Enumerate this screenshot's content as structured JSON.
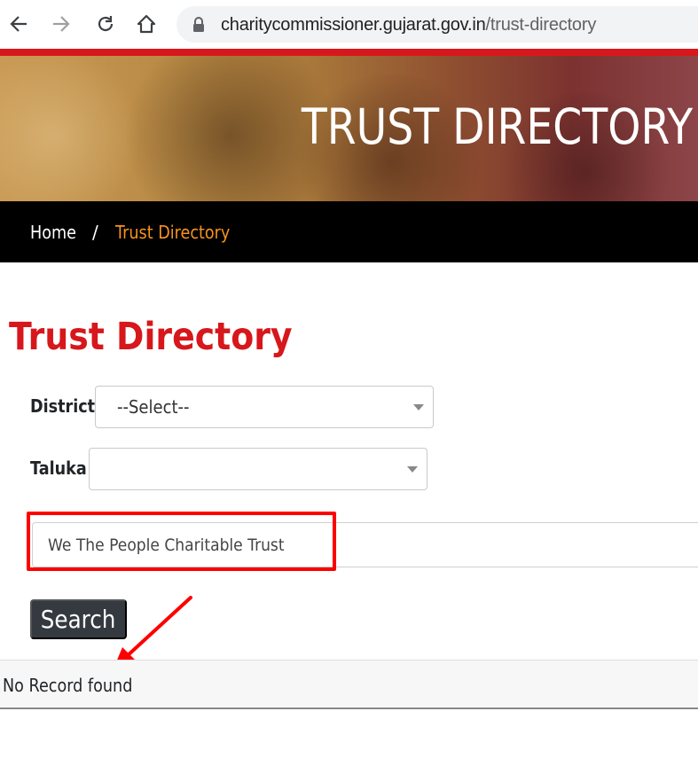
{
  "browser": {
    "url_domain": "charitycommissioner.gujarat.gov.in",
    "url_path": "/trust-directory",
    "icons": [
      "back-arrow-icon",
      "forward-arrow-icon",
      "reload-icon",
      "home-icon",
      "lock-icon"
    ]
  },
  "banner": {
    "title": "TRUST DIRECTORY"
  },
  "breadcrumb": {
    "home": "Home",
    "separator": "/",
    "current": "Trust Directory"
  },
  "main": {
    "title": "Trust Directory",
    "district": {
      "label": "District",
      "selected": "--Select--"
    },
    "taluka": {
      "label": "Taluka",
      "selected": ""
    },
    "trust_name_input": {
      "value": "We The People Charitable Trust"
    },
    "search_button": "Search",
    "result_message": "No Record found"
  },
  "colors": {
    "brand_red": "#d7171b",
    "breadcrumb_active": "#f7931e",
    "button_dark": "#343a40",
    "annotation_red": "#ff0000"
  }
}
